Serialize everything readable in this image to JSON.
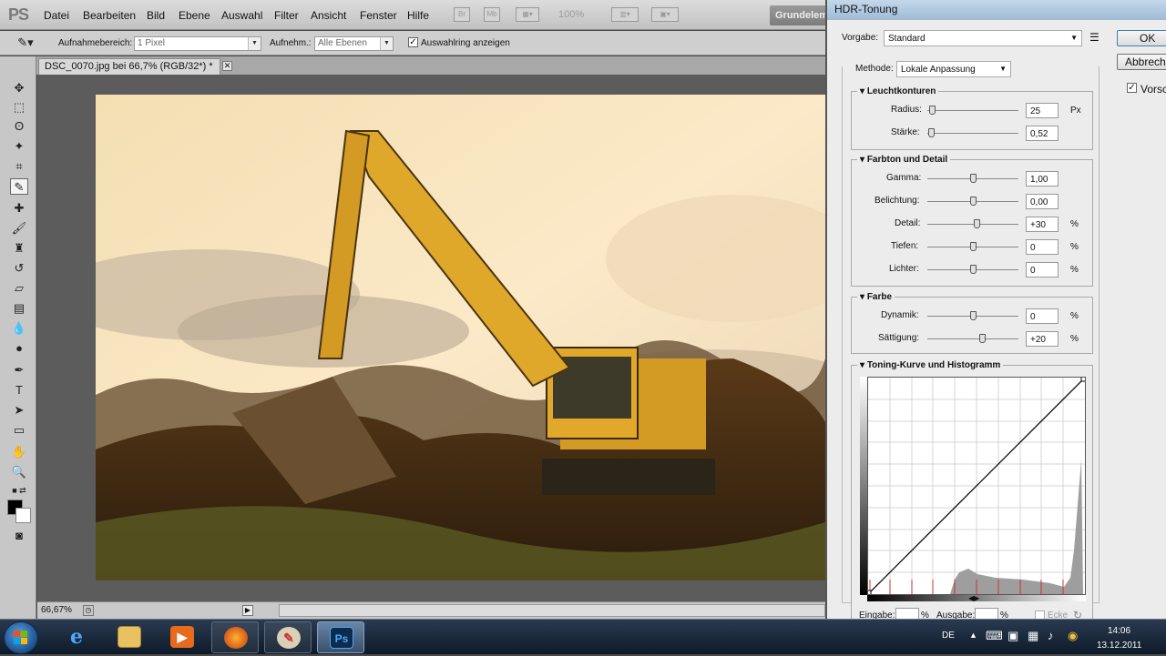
{
  "menubar": {
    "app_logo": "PS",
    "items": [
      "Datei",
      "Bearbeiten",
      "Bild",
      "Ebene",
      "Auswahl",
      "Filter",
      "Ansicht",
      "Fenster",
      "Hilfe"
    ],
    "icon_labels": [
      "Br",
      "Mb"
    ],
    "zoom": "100%",
    "workspace": "Grundelem"
  },
  "options_bar": {
    "sample_size_label": "Aufnahmebereich:",
    "sample_size_value": "1 Pixel",
    "sample_label": "Aufnehm.:",
    "sample_value": "Alle Ebenen",
    "show_ring_label": "Auswahlring anzeigen",
    "show_ring_checked": true
  },
  "document": {
    "tab_title": "DSC_0070.jpg bei 66,7% (RGB/32*) *",
    "zoom_status": "66,67%"
  },
  "hdr_dialog": {
    "title": "HDR-Tonung",
    "preset_label": "Vorgabe:",
    "preset_value": "Standard",
    "ok_label": "OK",
    "cancel_label": "Abbrech",
    "preview_label": "Vorsc",
    "preview_checked": true,
    "method_label": "Methode:",
    "method_value": "Lokale Anpassung",
    "edge_glow": {
      "title": "Leuchtkonturen",
      "radius_label": "Radius:",
      "radius_value": "25",
      "radius_unit": "Px",
      "radius_pos": 0.05,
      "strength_label": "Stärke:",
      "strength_value": "0,52",
      "strength_pos": 0.04
    },
    "tone_detail": {
      "title": "Farbton und Detail",
      "gamma_label": "Gamma:",
      "gamma_value": "1,00",
      "gamma_pos": 0.5,
      "exposure_label": "Belichtung:",
      "exposure_value": "0,00",
      "exposure_pos": 0.5,
      "detail_label": "Detail:",
      "detail_value": "+30",
      "detail_unit": "%",
      "detail_pos": 0.54,
      "shadow_label": "Tiefen:",
      "shadow_value": "0",
      "shadow_unit": "%",
      "shadow_pos": 0.5,
      "highlight_label": "Lichter:",
      "highlight_value": "0",
      "highlight_unit": "%",
      "highlight_pos": 0.5
    },
    "color": {
      "title": "Farbe",
      "vibrance_label": "Dynamik:",
      "vibrance_value": "0",
      "vibrance_unit": "%",
      "vibrance_pos": 0.5,
      "saturation_label": "Sättigung:",
      "saturation_value": "+20",
      "saturation_unit": "%",
      "saturation_pos": 0.6
    },
    "curve": {
      "title": "Toning-Kurve und Histogramm",
      "input_label": "Eingabe:",
      "input_unit": "%",
      "output_label": "Ausgabe:",
      "output_unit": "%",
      "corner_label": "Ecke"
    }
  },
  "taskbar": {
    "language": "DE",
    "time": "14:06",
    "date": "13.12.2011",
    "ps_label": "Ps"
  }
}
